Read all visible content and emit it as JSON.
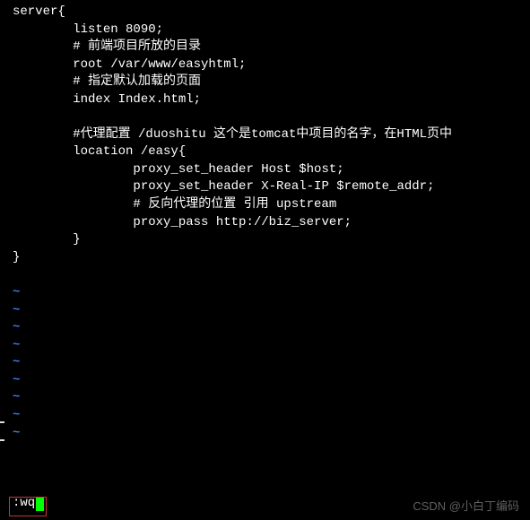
{
  "code": {
    "lines": [
      "server{",
      "        listen 8090;",
      "        # 前端项目所放的目录",
      "        root /var/www/easyhtml;",
      "        # 指定默认加载的页面",
      "        index Index.html;",
      "",
      "        #代理配置 /duoshitu 这个是tomcat中项目的名字，在HTML页中",
      "        location /easy{",
      "                proxy_set_header Host $host;",
      "                proxy_set_header X-Real-IP $remote_addr;",
      "                # 反向代理的位置 引用 upstream",
      "                proxy_pass http://biz_server;",
      "        }",
      "}"
    ]
  },
  "tilde_chars": [
    "~",
    "~",
    "~",
    "~",
    "~",
    "~",
    "~",
    "~",
    "~"
  ],
  "command": ":wq",
  "watermark": "CSDN @小白丁编码"
}
